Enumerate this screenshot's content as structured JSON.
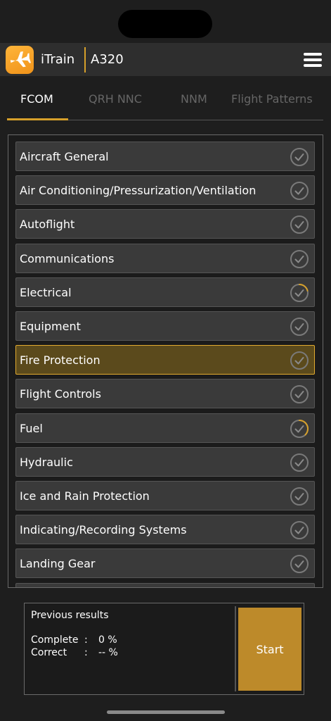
{
  "header": {
    "app_name": "iTrain",
    "model": "A320",
    "logo_icon": "airplane-icon",
    "menu_icon": "hamburger-menu-icon"
  },
  "tabs": [
    {
      "label": "FCOM",
      "active": true
    },
    {
      "label": "QRH NNC",
      "active": false
    },
    {
      "label": "NNM",
      "active": false
    },
    {
      "label": "Flight Patterns",
      "active": false
    }
  ],
  "list": {
    "items": [
      {
        "label": "Aircraft General",
        "status": "check"
      },
      {
        "label": "Air Conditioning/Pressurization/Ventilation",
        "status": "check"
      },
      {
        "label": "Autoflight",
        "status": "check"
      },
      {
        "label": "Communications",
        "status": "check"
      },
      {
        "label": "Electrical",
        "status": "in-progress"
      },
      {
        "label": "Equipment",
        "status": "check"
      },
      {
        "label": "Fire Protection",
        "status": "check",
        "selected": true
      },
      {
        "label": "Flight Controls",
        "status": "check"
      },
      {
        "label": "Fuel",
        "status": "in-progress"
      },
      {
        "label": "Hydraulic",
        "status": "check"
      },
      {
        "label": "Ice and Rain Protection",
        "status": "check"
      },
      {
        "label": "Indicating/Recording Systems",
        "status": "check"
      },
      {
        "label": "Landing Gear",
        "status": "check"
      }
    ]
  },
  "results": {
    "title": "Previous results",
    "complete_label": "Complete",
    "complete_value": "0 %",
    "correct_label": "Correct",
    "correct_value": "-- %",
    "separator": ":"
  },
  "start_label": "Start",
  "colors": {
    "accent": "#d6a02a",
    "selected_bg": "#5b4a1c",
    "button": "#bd8a2a"
  }
}
